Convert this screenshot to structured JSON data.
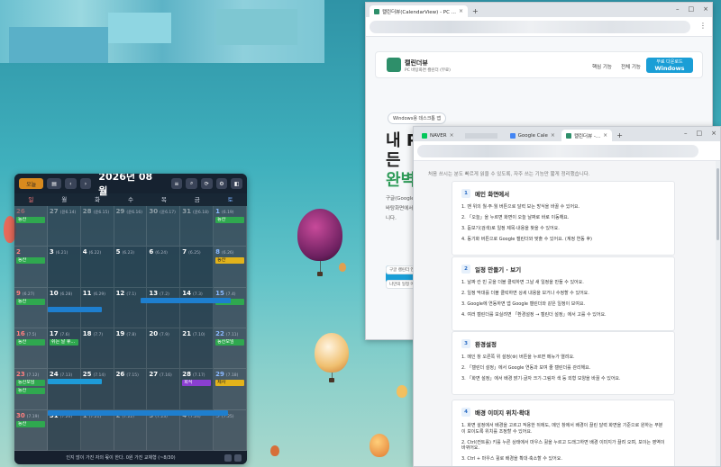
{
  "calendar": {
    "today_button": "오늘",
    "month_title": "2026년 08월",
    "weekdays": [
      "일",
      "월",
      "화",
      "수",
      "목",
      "금",
      "토"
    ],
    "weeks": [
      [
        {
          "d": "26",
          "l": "",
          "o": true
        },
        {
          "d": "27",
          "l": "(윤6.14)",
          "o": true
        },
        {
          "d": "28",
          "l": "(윤6.15)",
          "o": true
        },
        {
          "d": "29",
          "l": "(윤6.16)",
          "o": true
        },
        {
          "d": "30",
          "l": "(윤6.17)",
          "o": true
        },
        {
          "d": "31",
          "l": "(윤6.18)",
          "o": true
        },
        {
          "d": "1",
          "l": "(6.19)"
        }
      ],
      [
        {
          "d": "2",
          "l": ""
        },
        {
          "d": "3",
          "l": "(6.21)"
        },
        {
          "d": "4",
          "l": "(6.22)"
        },
        {
          "d": "5",
          "l": "(6.23)"
        },
        {
          "d": "6",
          "l": "(6.24)"
        },
        {
          "d": "7",
          "l": "(6.25)"
        },
        {
          "d": "8",
          "l": "(6.26)"
        }
      ],
      [
        {
          "d": "9",
          "l": "(6.27)"
        },
        {
          "d": "10",
          "l": "(6.28)"
        },
        {
          "d": "11",
          "l": "(6.29)"
        },
        {
          "d": "12",
          "l": "(7.1)"
        },
        {
          "d": "13",
          "l": "(7.2)"
        },
        {
          "d": "14",
          "l": "(7.3)"
        },
        {
          "d": "15",
          "l": "(7.4)"
        }
      ],
      [
        {
          "d": "16",
          "l": "(7.5)"
        },
        {
          "d": "17",
          "l": "(7.6)"
        },
        {
          "d": "18",
          "l": "(7.7)"
        },
        {
          "d": "19",
          "l": "(7.8)"
        },
        {
          "d": "20",
          "l": "(7.9)"
        },
        {
          "d": "21",
          "l": "(7.10)"
        },
        {
          "d": "22",
          "l": "(7.11)"
        }
      ],
      [
        {
          "d": "23",
          "l": "(7.12)"
        },
        {
          "d": "24",
          "l": "(7.13)"
        },
        {
          "d": "25",
          "l": "(7.14)"
        },
        {
          "d": "26",
          "l": "(7.15)"
        },
        {
          "d": "27",
          "l": "(7.16)"
        },
        {
          "d": "28",
          "l": "(7.17)"
        },
        {
          "d": "29",
          "l": "(7.18)"
        }
      ],
      [
        {
          "d": "30",
          "l": "(7.19)"
        },
        {
          "d": "31",
          "l": "(7.20)"
        },
        {
          "d": "1",
          "l": "(7.21)",
          "o": true
        },
        {
          "d": "2",
          "l": "(7.22)",
          "o": true
        },
        {
          "d": "3",
          "l": "(7.23)",
          "o": true
        },
        {
          "d": "4",
          "l": "(7.24)",
          "o": true
        },
        {
          "d": "5",
          "l": "(7.25)",
          "o": true
        }
      ]
    ],
    "events": {
      "0-0": [
        {
          "t": "등산",
          "c": "green"
        }
      ],
      "0-6": [
        {
          "t": "등산",
          "c": "green"
        }
      ],
      "1-0": [
        {
          "t": "등산",
          "c": "green"
        }
      ],
      "1-6": [
        {
          "t": "등산",
          "c": "yellow"
        }
      ],
      "2-0": [
        {
          "t": "등산",
          "c": "green"
        }
      ],
      "2-6": [
        {
          "t": "광복절",
          "c": "green"
        }
      ],
      "3-0": [
        {
          "t": "등산",
          "c": "green"
        }
      ],
      "3-1": [
        {
          "t": "쉬는 날 휴...",
          "c": "green"
        }
      ],
      "3-6": [
        {
          "t": "등산모임",
          "c": "green"
        }
      ],
      "4-0": [
        {
          "t": "등산모임",
          "c": "green"
        },
        {
          "t": "등산",
          "c": "green"
        }
      ],
      "4-5": [
        {
          "t": "회식",
          "c": "purple"
        }
      ],
      "4-6": [
        {
          "t": "제사",
          "c": "yellow"
        }
      ],
      "5-0": [
        {
          "t": "등산",
          "c": "green"
        }
      ]
    },
    "footer": "인지 많이 가진 자의 몫이 한다. 0원 가진 교체형 (~8/30)"
  },
  "browser1": {
    "tab_title": "캘린더뷰(CalendarView) - PC ...",
    "site_name": "캘린더뷰",
    "site_sub": "PC 바탕화면 캘린더 (무료)",
    "nav": [
      "핵심 기능",
      "전체 기능"
    ],
    "cta_small": "무료 다운로드",
    "cta_big": "Windows",
    "pill": "Windows용 데스크톱 앱",
    "hero1": "내 PC",
    "hero2": "든",
    "hero3": "완벽",
    "desc1": "구글(Google",
    "desc2": "바탕화면에서",
    "desc3": "니다.",
    "chips": [
      "구글 캘린더 연동",
      "나만의 일정 메"
    ]
  },
  "browser2": {
    "tabs": [
      "NAVER",
      "Google Cale",
      "캘린더뷰 -..."
    ],
    "intro": "처음 쓰시는 분도 빠르게 읽을 수 있도록, 자주 쓰는 기능만 짧게 정리했습니다.",
    "sections": [
      {
        "n": "1",
        "title": "메인 화면에서",
        "items": [
          "1. 맨 위의 월·주·월 버튼으로 달력 보는 방식을 바꿀 수 있어요.",
          "2. 「오늘」을 누르면 화면이 오늘 날짜로 바로 이동해요.",
          "3. 돋보기(검색)로 일정 제목·내용을 찾을 수 있어요.",
          "4. 동기화 버튼으로 Google 캘린더와 맞출 수 있어요. (계정 연동 후)"
        ]
      },
      {
        "n": "2",
        "title": "일정 만들기 · 보기",
        "items": [
          "1. 날짜 칸 빈 곳을 더블 클릭하면 그날 새 일정을 만들 수 있어요.",
          "2. 일정 막대를 더블 클릭하면 상세 내용을 보거나 수정할 수 있어요.",
          "3. Google에 연동하면 앱 Google 캘린더와 같은 일정이 보여요.",
          "4. 여러 캘린더를 보실려면 「환경설정 → 캘린더 설정」에서 고를 수 있어요."
        ]
      },
      {
        "n": "3",
        "title": "환경설정",
        "items": [
          "1. 메인 창 오른쪽 위 설정(⚙) 버튼을 누르면 메뉴가 열려요.",
          "2. 「캘린더 설정」에서 Google 연동과 보여 줄 캘린더를 관리해요.",
          "3. 「화면 설정」에서 배경 밝기·글자 크기·그림자 색 등 외형 모양을 바꿀 수 있어요."
        ]
      },
      {
        "n": "4",
        "title": "배경 이미지 위치·확대",
        "items": [
          "1. 화면 설정에서 배경을 고르고 적용한 뒤에도, 메인 창에서 배경이 끌린 달력 화면을 기준으로 원하는 부분이 보이도록 위치를 조정할 수 있어요.",
          "2. Ctrl(컨트롤) 키를 누른 상태에서 마우스 휠을 누르고 드래그하면 배경 이미지가 끌려 오며, 보이는 영역이 바뀌어요.",
          "3. Ctrl + 마우스 휠로 배경을 확대·축소할 수 있어요."
        ]
      }
    ]
  }
}
